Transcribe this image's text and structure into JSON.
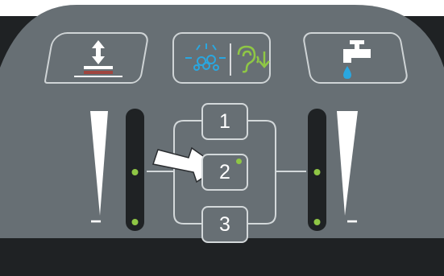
{
  "buttons": {
    "left": {
      "icon": "brush-height-icon"
    },
    "middle": {
      "icons": [
        "spray-icon",
        "ear-icon"
      ]
    },
    "right": {
      "icon": "water-faucet-icon"
    }
  },
  "zones": [
    {
      "label": "1",
      "active": false
    },
    {
      "label": "2",
      "active": true
    },
    {
      "label": "3",
      "active": false
    }
  ],
  "left_slider": {
    "plus": "+",
    "minus": "−",
    "active_leds": 2,
    "total_leds": 3
  },
  "right_slider": {
    "plus": "+",
    "minus": "−",
    "active_leds": 2,
    "total_leds": 3
  },
  "colors": {
    "panel": "#676f74",
    "border": "#d3d8da",
    "led_on": "#8fc745",
    "accent_blue": "#2aa7e0",
    "accent_green": "#8fc745",
    "accent_red": "#a0453f"
  }
}
